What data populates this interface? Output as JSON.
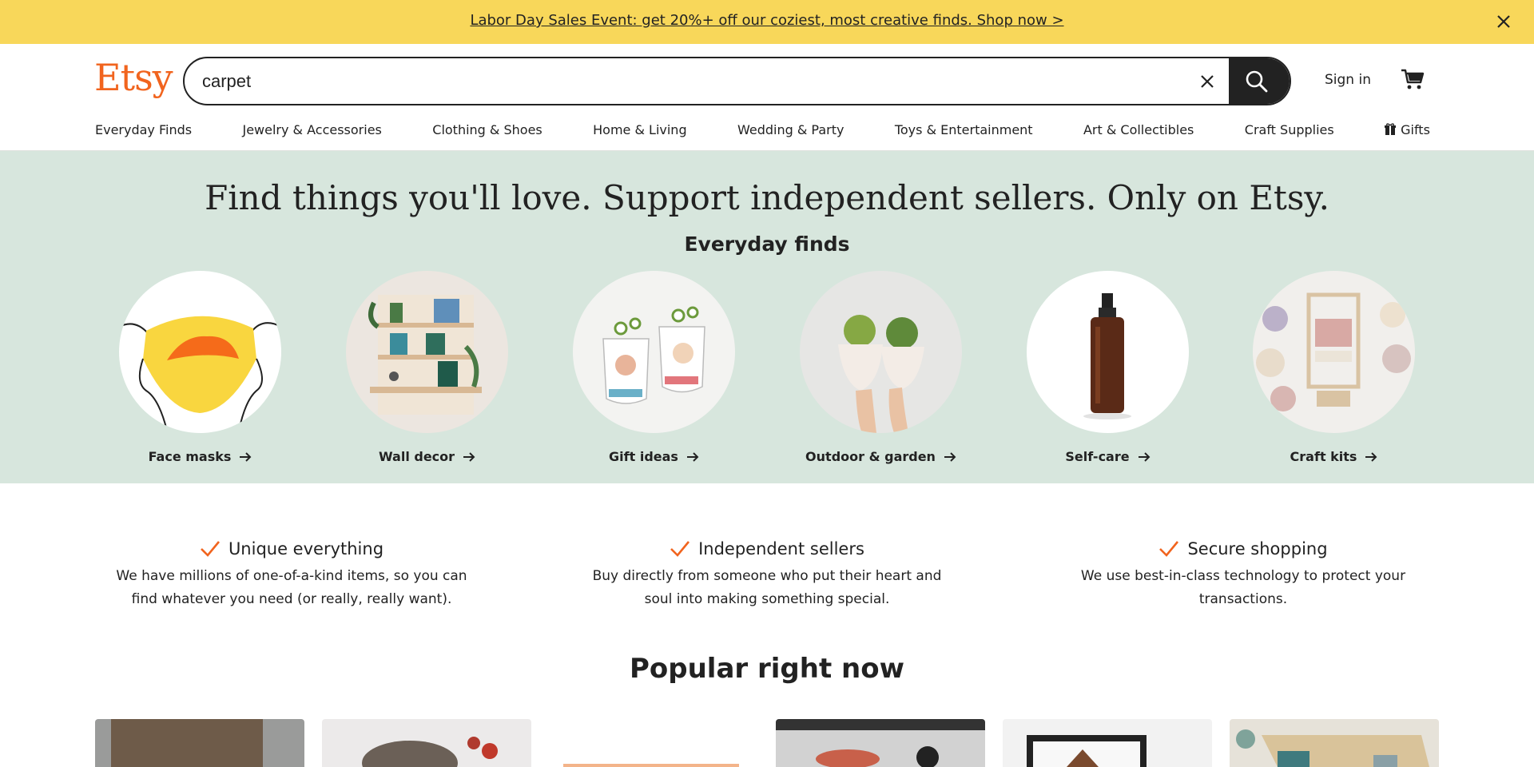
{
  "banner": {
    "text": "Labor Day Sales Event: get 20%+ off our coziest, most creative finds. Shop now >",
    "close_icon": "close-icon"
  },
  "header": {
    "logo": "Etsy",
    "search": {
      "value": "carpet"
    },
    "sign_in": "Sign in",
    "cart_icon": "cart-icon"
  },
  "nav": {
    "items": [
      "Everyday Finds",
      "Jewelry & Accessories",
      "Clothing & Shoes",
      "Home & Living",
      "Wedding & Party",
      "Toys & Entertainment",
      "Art & Collectibles",
      "Craft Supplies",
      "Gifts"
    ]
  },
  "hero": {
    "title": "Find things you'll love. Support independent sellers. Only on Etsy.",
    "subtitle": "Everyday finds",
    "categories": [
      {
        "label": "Face masks"
      },
      {
        "label": "Wall decor"
      },
      {
        "label": "Gift ideas"
      },
      {
        "label": "Outdoor & garden"
      },
      {
        "label": "Self-care"
      },
      {
        "label": "Craft kits"
      }
    ]
  },
  "values": [
    {
      "title": "Unique everything",
      "body": "We have millions of one-of-a-kind items, so you can find whatever you need (or really, really want)."
    },
    {
      "title": "Independent sellers",
      "body": "Buy directly from someone who put their heart and soul into making something special."
    },
    {
      "title": "Secure shopping",
      "body": "We use best-in-class technology to protect your transactions."
    }
  ],
  "popular": {
    "title": "Popular right now"
  },
  "colors": {
    "brand": "#f1641e",
    "banner": "#f8d75a",
    "hero_bg": "#d7e6dd",
    "dark": "#222222"
  }
}
